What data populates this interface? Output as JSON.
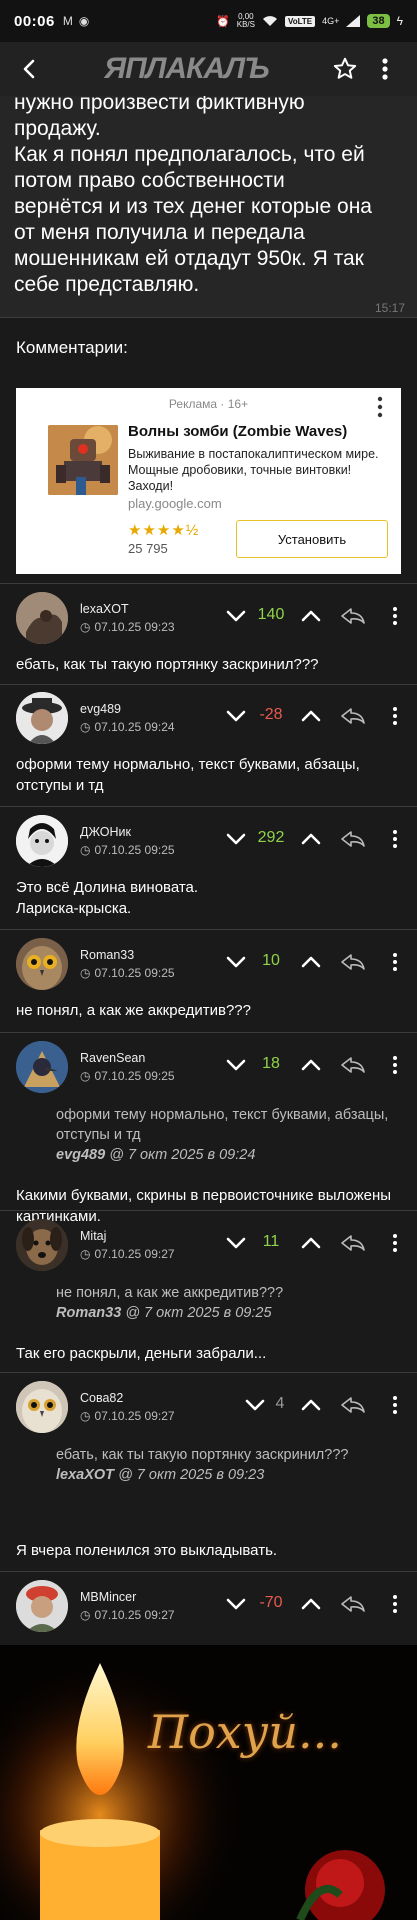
{
  "status_bar": {
    "time": "00:06",
    "net_speed": "0,00",
    "net_unit": "KB/S",
    "volte": "VoLTE",
    "network": "4G+",
    "battery": "38"
  },
  "nav": {
    "logo_text": "ЯПЛАКАЛЪ"
  },
  "post": {
    "text_lines": [
      "нужно произвести фиктивную",
      "продажу.",
      "Как я понял предполагалось, что ей",
      "потом право собственности",
      "вернётся и из тех денег которые она",
      "от меня получила и передала",
      "мошенникам ей отдадут 950к. Я так",
      "себе представляю."
    ],
    "time_partial": "15:17"
  },
  "comments_header": "Комментарии:",
  "ad": {
    "label": "Реклама · 16+",
    "title": "Волны зомби (Zombie Waves)",
    "description": "Выживание в постапокалиптическом мире. Мощные дробовики, точные винтовки! Заходи!",
    "url": "play.google.com",
    "rating": 4.5,
    "stars_text": "★★★★½",
    "reviews": "25 795",
    "install_label": "Установить"
  },
  "comments": [
    {
      "author": "lexaXOT",
      "date": "07.10.25 09:23",
      "rating": "140",
      "text": "ебать, как ты такую портянку заскринил???"
    },
    {
      "author": "evg489",
      "date": "07.10.25 09:24",
      "rating": "-28",
      "text": "оформи тему нормально, текст буквами, абзацы, отступы и тд"
    },
    {
      "author": "ДЖОНик",
      "date": "07.10.25 09:25",
      "rating": "292",
      "text_line1": "Это всё Долина виновата.",
      "text_line2": "Лариска-крыска."
    },
    {
      "author": "Roman33",
      "date": "07.10.25 09:25",
      "rating": "10",
      "text": "не понял, а как же аккредитив???"
    },
    {
      "author": "RavenSean",
      "date": "07.10.25 09:25",
      "rating": "18",
      "quote": "оформи тему нормально, текст буквами, абзацы, отступы и тд",
      "quote_author": "evg489",
      "quote_date": "@ 7 окт 2025 в 09:24",
      "text": "Какими буквами, скрины в первоисточнике выложены картинками."
    },
    {
      "author": "Mitaj",
      "date": "07.10.25 09:27",
      "rating": "11",
      "quote": "не понял, а как же аккредитив???",
      "quote_author": "Roman33",
      "quote_date": "@ 7 окт 2025 в 09:25",
      "text": "Так его раскрыли, деньги забрали..."
    },
    {
      "author": "Сова82",
      "date": "07.10.25 09:27",
      "rating": "4",
      "quote": "ебать, как ты такую портянку заскринил???",
      "quote_author": "lexaXOT",
      "quote_date": "@ 7 окт 2025 в 09:23",
      "text": "Я вчера поленился это выкладывать."
    },
    {
      "author": "MBMincer",
      "date": "07.10.25 09:27",
      "rating": "-70",
      "image_caption": "Похуй..."
    }
  ],
  "colors": {
    "positive": "#8fd34a",
    "negative": "#e85a4f",
    "neutral": "#9a9a9a",
    "background": "#1a1a1a"
  }
}
